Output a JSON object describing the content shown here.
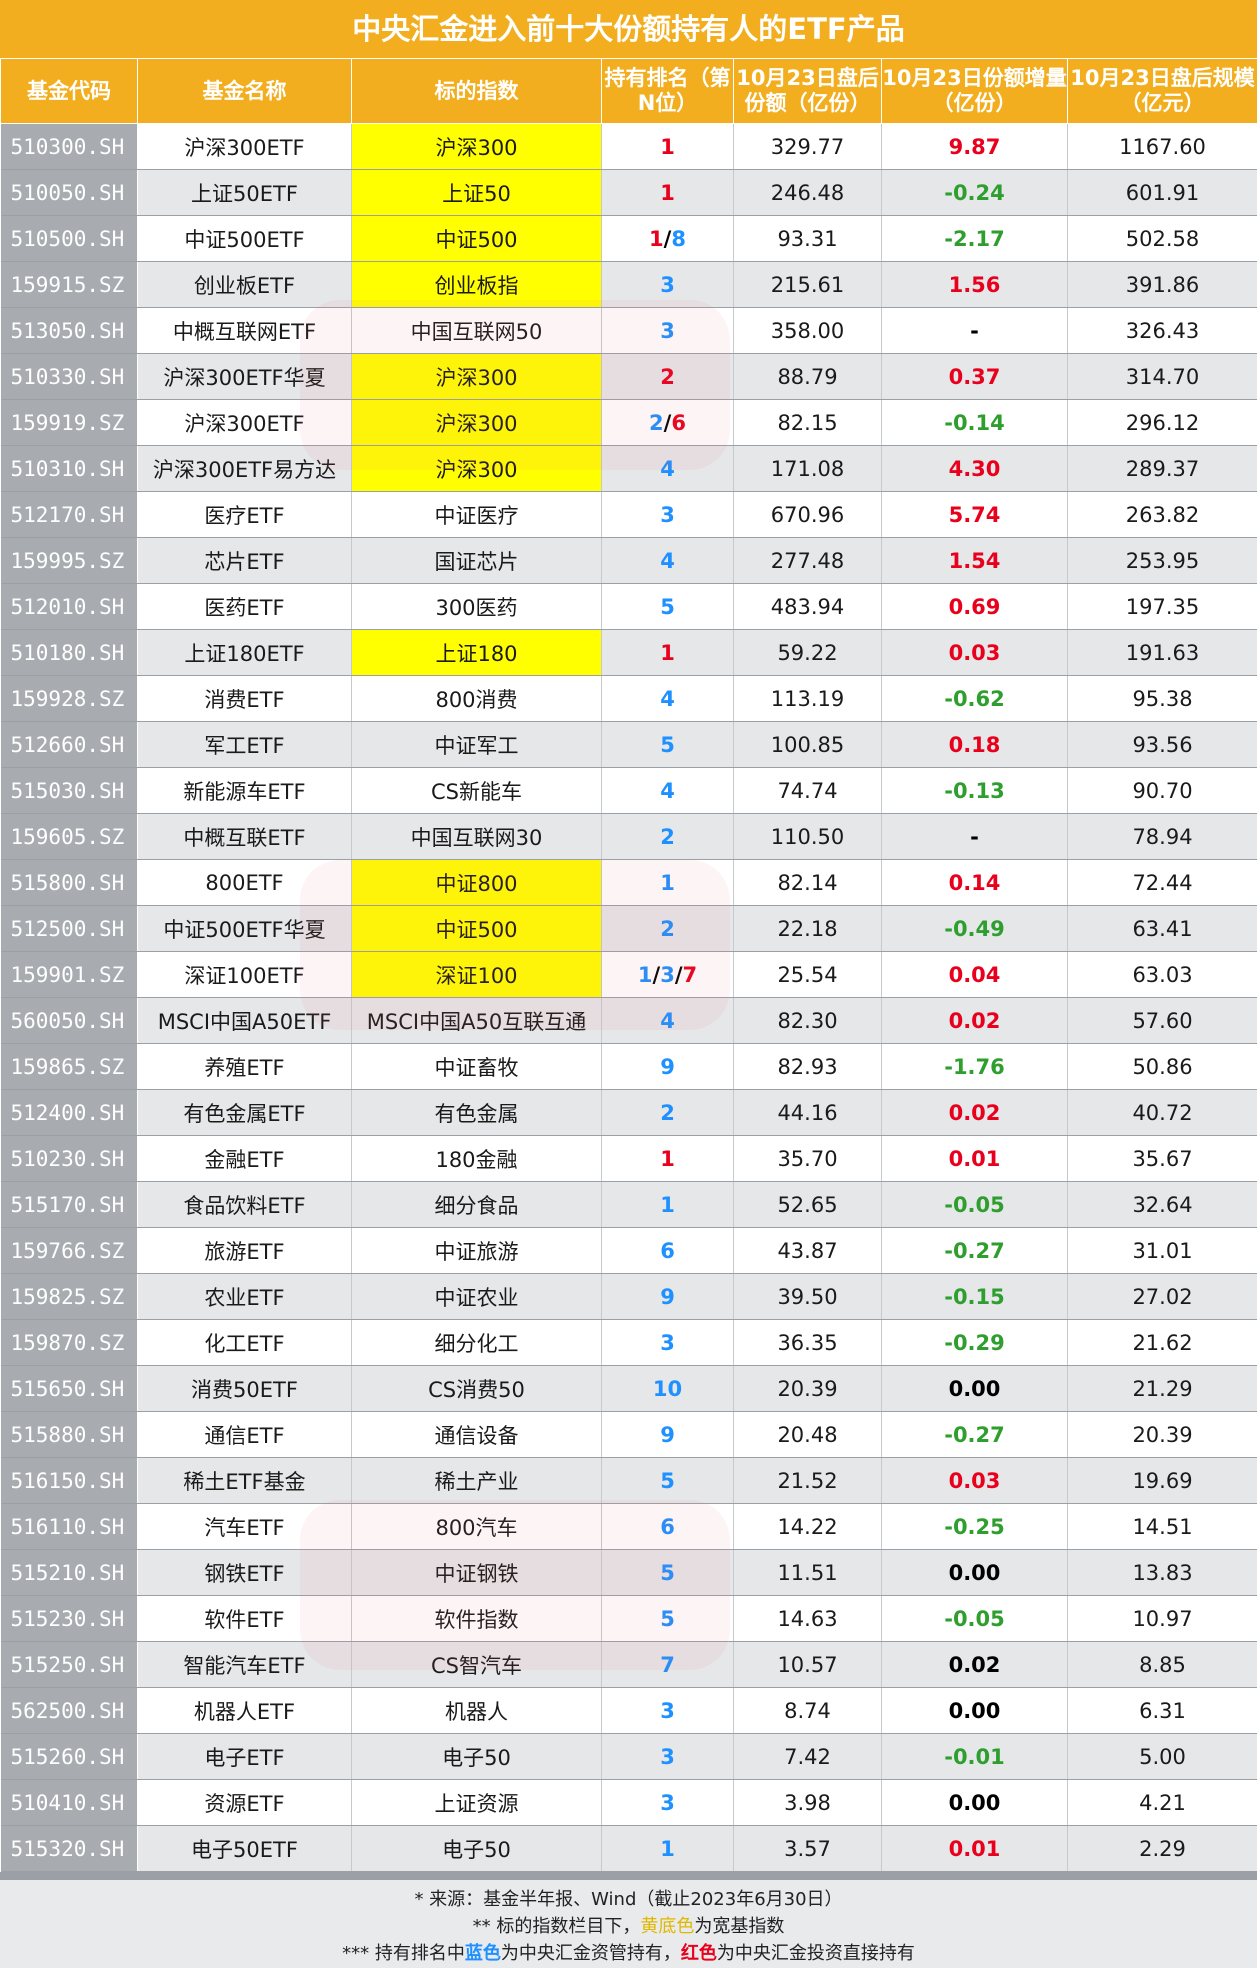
{
  "title": "中央汇金进入前十大份额持有人的ETF产品",
  "headers": [
    "基金代码",
    "基金名称",
    "标的指数",
    "持有排名（第N位）",
    "10月23日盘后份额（亿份）",
    "10月23日份额增量（亿份）",
    "10月23日盘后规模（亿元）"
  ],
  "rows": [
    {
      "code": "510300.SH",
      "name": "沪深300ETF",
      "index": "沪深300",
      "broad": true,
      "rank": [
        {
          "t": "1",
          "c": "red"
        }
      ],
      "shares": "329.77",
      "delta": "9.87",
      "dc": "red",
      "scale": "1167.60"
    },
    {
      "code": "510050.SH",
      "name": "上证50ETF",
      "index": "上证50",
      "broad": true,
      "rank": [
        {
          "t": "1",
          "c": "red"
        }
      ],
      "shares": "246.48",
      "delta": "-0.24",
      "dc": "green",
      "scale": "601.91"
    },
    {
      "code": "510500.SH",
      "name": "中证500ETF",
      "index": "中证500",
      "broad": true,
      "rank": [
        {
          "t": "1",
          "c": "red"
        },
        {
          "t": "/",
          "c": "black"
        },
        {
          "t": "8",
          "c": "blue"
        }
      ],
      "shares": "93.31",
      "delta": "-2.17",
      "dc": "green",
      "scale": "502.58"
    },
    {
      "code": "159915.SZ",
      "name": "创业板ETF",
      "index": "创业板指",
      "broad": true,
      "rank": [
        {
          "t": "3",
          "c": "blue"
        }
      ],
      "shares": "215.61",
      "delta": "1.56",
      "dc": "red",
      "scale": "391.86"
    },
    {
      "code": "513050.SH",
      "name": "中概互联网ETF",
      "index": "中国互联网50",
      "broad": false,
      "rank": [
        {
          "t": "3",
          "c": "blue"
        }
      ],
      "shares": "358.00",
      "delta": "-",
      "dc": "black",
      "scale": "326.43"
    },
    {
      "code": "510330.SH",
      "name": "沪深300ETF华夏",
      "index": "沪深300",
      "broad": true,
      "rank": [
        {
          "t": "2",
          "c": "red"
        }
      ],
      "shares": "88.79",
      "delta": "0.37",
      "dc": "red",
      "scale": "314.70"
    },
    {
      "code": "159919.SZ",
      "name": "沪深300ETF",
      "index": "沪深300",
      "broad": true,
      "rank": [
        {
          "t": "2",
          "c": "blue"
        },
        {
          "t": "/",
          "c": "black"
        },
        {
          "t": "6",
          "c": "red"
        }
      ],
      "shares": "82.15",
      "delta": "-0.14",
      "dc": "green",
      "scale": "296.12"
    },
    {
      "code": "510310.SH",
      "name": "沪深300ETF易方达",
      "index": "沪深300",
      "broad": true,
      "rank": [
        {
          "t": "4",
          "c": "blue"
        }
      ],
      "shares": "171.08",
      "delta": "4.30",
      "dc": "red",
      "scale": "289.37"
    },
    {
      "code": "512170.SH",
      "name": "医疗ETF",
      "index": "中证医疗",
      "broad": false,
      "rank": [
        {
          "t": "3",
          "c": "blue"
        }
      ],
      "shares": "670.96",
      "delta": "5.74",
      "dc": "red",
      "scale": "263.82"
    },
    {
      "code": "159995.SZ",
      "name": "芯片ETF",
      "index": "国证芯片",
      "broad": false,
      "rank": [
        {
          "t": "4",
          "c": "blue"
        }
      ],
      "shares": "277.48",
      "delta": "1.54",
      "dc": "red",
      "scale": "253.95"
    },
    {
      "code": "512010.SH",
      "name": "医药ETF",
      "index": "300医药",
      "broad": false,
      "rank": [
        {
          "t": "5",
          "c": "blue"
        }
      ],
      "shares": "483.94",
      "delta": "0.69",
      "dc": "red",
      "scale": "197.35"
    },
    {
      "code": "510180.SH",
      "name": "上证180ETF",
      "index": "上证180",
      "broad": true,
      "rank": [
        {
          "t": "1",
          "c": "red"
        }
      ],
      "shares": "59.22",
      "delta": "0.03",
      "dc": "red",
      "scale": "191.63"
    },
    {
      "code": "159928.SZ",
      "name": "消费ETF",
      "index": "800消费",
      "broad": false,
      "rank": [
        {
          "t": "4",
          "c": "blue"
        }
      ],
      "shares": "113.19",
      "delta": "-0.62",
      "dc": "green",
      "scale": "95.38"
    },
    {
      "code": "512660.SH",
      "name": "军工ETF",
      "index": "中证军工",
      "broad": false,
      "rank": [
        {
          "t": "5",
          "c": "blue"
        }
      ],
      "shares": "100.85",
      "delta": "0.18",
      "dc": "red",
      "scale": "93.56"
    },
    {
      "code": "515030.SH",
      "name": "新能源车ETF",
      "index": "CS新能车",
      "broad": false,
      "rank": [
        {
          "t": "4",
          "c": "blue"
        }
      ],
      "shares": "74.74",
      "delta": "-0.13",
      "dc": "green",
      "scale": "90.70"
    },
    {
      "code": "159605.SZ",
      "name": "中概互联ETF",
      "index": "中国互联网30",
      "broad": false,
      "rank": [
        {
          "t": "2",
          "c": "blue"
        }
      ],
      "shares": "110.50",
      "delta": "-",
      "dc": "black",
      "scale": "78.94"
    },
    {
      "code": "515800.SH",
      "name": "800ETF",
      "index": "中证800",
      "broad": true,
      "rank": [
        {
          "t": "1",
          "c": "blue"
        }
      ],
      "shares": "82.14",
      "delta": "0.14",
      "dc": "red",
      "scale": "72.44"
    },
    {
      "code": "512500.SH",
      "name": "中证500ETF华夏",
      "index": "中证500",
      "broad": true,
      "rank": [
        {
          "t": "2",
          "c": "blue"
        }
      ],
      "shares": "22.18",
      "delta": "-0.49",
      "dc": "green",
      "scale": "63.41"
    },
    {
      "code": "159901.SZ",
      "name": "深证100ETF",
      "index": "深证100",
      "broad": true,
      "rank": [
        {
          "t": "1",
          "c": "blue"
        },
        {
          "t": "/",
          "c": "black"
        },
        {
          "t": "3",
          "c": "blue"
        },
        {
          "t": "/",
          "c": "black"
        },
        {
          "t": "7",
          "c": "red"
        }
      ],
      "shares": "25.54",
      "delta": "0.04",
      "dc": "red",
      "scale": "63.03"
    },
    {
      "code": "560050.SH",
      "name": "MSCI中国A50ETF",
      "index": "MSCI中国A50互联互通",
      "broad": false,
      "rank": [
        {
          "t": "4",
          "c": "blue"
        }
      ],
      "shares": "82.30",
      "delta": "0.02",
      "dc": "red",
      "scale": "57.60"
    },
    {
      "code": "159865.SZ",
      "name": "养殖ETF",
      "index": "中证畜牧",
      "broad": false,
      "rank": [
        {
          "t": "9",
          "c": "blue"
        }
      ],
      "shares": "82.93",
      "delta": "-1.76",
      "dc": "green",
      "scale": "50.86"
    },
    {
      "code": "512400.SH",
      "name": "有色金属ETF",
      "index": "有色金属",
      "broad": false,
      "rank": [
        {
          "t": "2",
          "c": "blue"
        }
      ],
      "shares": "44.16",
      "delta": "0.02",
      "dc": "red",
      "scale": "40.72"
    },
    {
      "code": "510230.SH",
      "name": "金融ETF",
      "index": "180金融",
      "broad": false,
      "rank": [
        {
          "t": "1",
          "c": "red"
        }
      ],
      "shares": "35.70",
      "delta": "0.01",
      "dc": "red",
      "scale": "35.67"
    },
    {
      "code": "515170.SH",
      "name": "食品饮料ETF",
      "index": "细分食品",
      "broad": false,
      "rank": [
        {
          "t": "1",
          "c": "blue"
        }
      ],
      "shares": "52.65",
      "delta": "-0.05",
      "dc": "green",
      "scale": "32.64"
    },
    {
      "code": "159766.SZ",
      "name": "旅游ETF",
      "index": "中证旅游",
      "broad": false,
      "rank": [
        {
          "t": "6",
          "c": "blue"
        }
      ],
      "shares": "43.87",
      "delta": "-0.27",
      "dc": "green",
      "scale": "31.01"
    },
    {
      "code": "159825.SZ",
      "name": "农业ETF",
      "index": "中证农业",
      "broad": false,
      "rank": [
        {
          "t": "9",
          "c": "blue"
        }
      ],
      "shares": "39.50",
      "delta": "-0.15",
      "dc": "green",
      "scale": "27.02"
    },
    {
      "code": "159870.SZ",
      "name": "化工ETF",
      "index": "细分化工",
      "broad": false,
      "rank": [
        {
          "t": "3",
          "c": "blue"
        }
      ],
      "shares": "36.35",
      "delta": "-0.29",
      "dc": "green",
      "scale": "21.62"
    },
    {
      "code": "515650.SH",
      "name": "消费50ETF",
      "index": "CS消费50",
      "broad": false,
      "rank": [
        {
          "t": "10",
          "c": "blue"
        }
      ],
      "shares": "20.39",
      "delta": "0.00",
      "dc": "black",
      "scale": "21.29"
    },
    {
      "code": "515880.SH",
      "name": "通信ETF",
      "index": "通信设备",
      "broad": false,
      "rank": [
        {
          "t": "9",
          "c": "blue"
        }
      ],
      "shares": "20.48",
      "delta": "-0.27",
      "dc": "green",
      "scale": "20.39"
    },
    {
      "code": "516150.SH",
      "name": "稀土ETF基金",
      "index": "稀土产业",
      "broad": false,
      "rank": [
        {
          "t": "5",
          "c": "blue"
        }
      ],
      "shares": "21.52",
      "delta": "0.03",
      "dc": "red",
      "scale": "19.69"
    },
    {
      "code": "516110.SH",
      "name": "汽车ETF",
      "index": "800汽车",
      "broad": false,
      "rank": [
        {
          "t": "6",
          "c": "blue"
        }
      ],
      "shares": "14.22",
      "delta": "-0.25",
      "dc": "green",
      "scale": "14.51"
    },
    {
      "code": "515210.SH",
      "name": "钢铁ETF",
      "index": "中证钢铁",
      "broad": false,
      "rank": [
        {
          "t": "5",
          "c": "blue"
        }
      ],
      "shares": "11.51",
      "delta": "0.00",
      "dc": "black",
      "scale": "13.83"
    },
    {
      "code": "515230.SH",
      "name": "软件ETF",
      "index": "软件指数",
      "broad": false,
      "rank": [
        {
          "t": "5",
          "c": "blue"
        }
      ],
      "shares": "14.63",
      "delta": "-0.05",
      "dc": "green",
      "scale": "10.97"
    },
    {
      "code": "515250.SH",
      "name": "智能汽车ETF",
      "index": "CS智汽车",
      "broad": false,
      "rank": [
        {
          "t": "7",
          "c": "blue"
        }
      ],
      "shares": "10.57",
      "delta": "0.02",
      "dc": "black",
      "scale": "8.85"
    },
    {
      "code": "562500.SH",
      "name": "机器人ETF",
      "index": "机器人",
      "broad": false,
      "rank": [
        {
          "t": "3",
          "c": "blue"
        }
      ],
      "shares": "8.74",
      "delta": "0.00",
      "dc": "black",
      "scale": "6.31"
    },
    {
      "code": "515260.SH",
      "name": "电子ETF",
      "index": "电子50",
      "broad": false,
      "rank": [
        {
          "t": "3",
          "c": "blue"
        }
      ],
      "shares": "7.42",
      "delta": "-0.01",
      "dc": "green",
      "scale": "5.00"
    },
    {
      "code": "510410.SH",
      "name": "资源ETF",
      "index": "上证资源",
      "broad": false,
      "rank": [
        {
          "t": "3",
          "c": "blue"
        }
      ],
      "shares": "3.98",
      "delta": "0.00",
      "dc": "black",
      "scale": "4.21"
    },
    {
      "code": "515320.SH",
      "name": "电子50ETF",
      "index": "电子50",
      "broad": false,
      "rank": [
        {
          "t": "1",
          "c": "blue"
        }
      ],
      "shares": "3.57",
      "delta": "0.01",
      "dc": "red",
      "scale": "2.29"
    }
  ],
  "footnotes": {
    "line1": "* 来源：基金半年报、Wind（截止2023年6月30日）",
    "line2_a": "** 标的指数栏目下，",
    "line2_b": "黄底色",
    "line2_c": "为宽基指数",
    "line3_a": "*** 持有排名中",
    "line3_b": "蓝色",
    "line3_c": "为中央汇金资管持有，",
    "line3_d": "红色",
    "line3_e": "为中央汇金投资直接持有"
  },
  "colors": {
    "header": "#f2ae1e",
    "broad_index": "#ffff00",
    "blue_rank": "#1e90ff",
    "red": "#e8001c",
    "green": "#2e9e2e"
  }
}
